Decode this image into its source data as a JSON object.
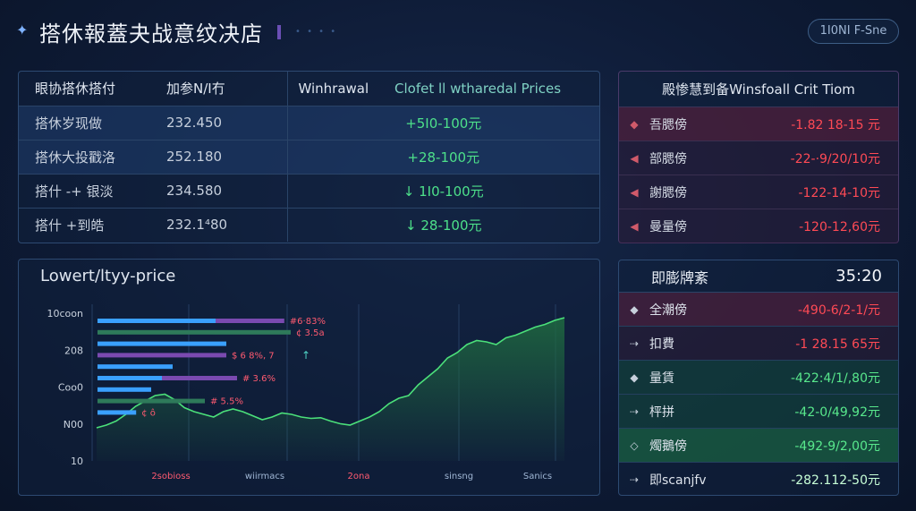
{
  "header": {
    "title": "搭休報蓋夬战意纹决店",
    "mode_label": "1I0NI F-Sne"
  },
  "prices_table": {
    "headers": [
      "眼协搭休搭付",
      "加参N/I冇",
      "Winhrawal",
      "Clofet ll wtharedal Prices"
    ],
    "rows": [
      {
        "name": "搭休岁现做",
        "value": "232.450",
        "price": "+5I0-100元"
      },
      {
        "name": "搭休大投戳洛",
        "value": "252.180",
        "price": "+28-100元"
      },
      {
        "name": "搭什 -+ 银淡",
        "value": "234.580",
        "price": "↓ 1I0-100元"
      },
      {
        "name": "搭什 +到皓",
        "value": "232.1⁴80",
        "price": "↓ 28-100元"
      }
    ]
  },
  "withdrawal_panel": {
    "title": "殿惨慧到备Winsfoall Crit Tiom",
    "rows": [
      {
        "icon": "◆",
        "label": "吾腮傍",
        "value": "-1.82 18-15 元"
      },
      {
        "icon": "◀",
        "label": "部腮傍",
        "value": "-22-·9/20/10元"
      },
      {
        "icon": "◀",
        "label": "謝腮傍",
        "value": "-122-14-10元"
      },
      {
        "icon": "◀",
        "label": "曼量傍",
        "value": "-120-12,60元"
      }
    ]
  },
  "live_panel": {
    "title": "即膨牌紊",
    "time": "35:20",
    "rows": [
      {
        "icon": "◆",
        "label": "全潮傍",
        "value": "-490-6/2-1/元",
        "kind": "neg"
      },
      {
        "icon": "⇢",
        "label": "扣費",
        "value": "-1 28.15 65元",
        "kind": "neg2"
      },
      {
        "icon": "◆",
        "label": "量賃",
        "value": "-422:4/1/,80元",
        "kind": "pos"
      },
      {
        "icon": "⇢",
        "label": "枰拼",
        "value": "-42-0/49,92元",
        "kind": "pos"
      },
      {
        "icon": "◇",
        "label": "燭鵝傍",
        "value": "-492-9/2,00元",
        "kind": "pos2"
      },
      {
        "icon": "⇢",
        "label": "即scanjfv",
        "value": "-282.112-50元",
        "kind": "plain"
      }
    ]
  },
  "chart_panel": {
    "title": "Lowert/ltyy-price"
  },
  "chart_data": {
    "type": "area",
    "title": "Lowert/ltyy-price",
    "y_tick_labels": [
      "10coon",
      "208",
      "Coo0",
      "N00",
      "10"
    ],
    "x_tick_labels": [
      "2sobioss",
      "wiirmacs",
      "2ona",
      "sinsng",
      "Sanics"
    ],
    "x": [
      0,
      0.25,
      0.5,
      0.75,
      1,
      1.25,
      1.5,
      1.75,
      2,
      2.25,
      2.5,
      2.75,
      3,
      3.25,
      3.5,
      3.75,
      4,
      4.25,
      4.5,
      4.75,
      5,
      5.25,
      5.5,
      5.75,
      6,
      6.25,
      6.5,
      6.75,
      7,
      7.25,
      7.5,
      7.75,
      8,
      8.25,
      8.5,
      8.75,
      9,
      9.25,
      9.5,
      9.75,
      10,
      10.25,
      10.5,
      10.75,
      11,
      11.25,
      11.5,
      11.75,
      12
    ],
    "y": [
      180,
      200,
      230,
      280,
      340,
      380,
      420,
      430,
      390,
      330,
      300,
      280,
      260,
      300,
      320,
      300,
      270,
      240,
      260,
      290,
      280,
      260,
      250,
      255,
      230,
      210,
      200,
      230,
      260,
      300,
      360,
      400,
      420,
      500,
      560,
      620,
      700,
      740,
      800,
      830,
      820,
      800,
      850,
      870,
      900,
      930,
      950,
      980,
      1000
    ],
    "ylim": [
      0,
      1100
    ],
    "bars": [
      {
        "label": "#6·83%",
        "values": [
          0.55,
          0.32
        ],
        "colors": [
          "#3aa0ff",
          "#7a4ab0"
        ]
      },
      {
        "label": "¢ 3.5a",
        "values": [
          0.9
        ],
        "colors": [
          "#2e7a5a"
        ]
      },
      {
        "label": "",
        "values": [
          0.6
        ],
        "colors": [
          "#3aa0ff"
        ]
      },
      {
        "label": "$ 6 8%, 7",
        "values": [
          0.6
        ],
        "colors": [
          "#7a4ab0"
        ]
      },
      {
        "label": "",
        "values": [
          0.35
        ],
        "colors": [
          "#3aa0ff"
        ]
      },
      {
        "label": "# 3.6%",
        "values": [
          0.3,
          0.35
        ],
        "colors": [
          "#3aa0ff",
          "#7a4ab0"
        ]
      },
      {
        "label": "",
        "values": [
          0.25
        ],
        "colors": [
          "#3aa0ff"
        ]
      },
      {
        "label": "# 5.5%",
        "values": [
          0.5
        ],
        "colors": [
          "#2e7a5a"
        ]
      },
      {
        "label": "¢ ô",
        "values": [
          0.18
        ],
        "colors": [
          "#3aa0ff"
        ]
      }
    ],
    "colors": {
      "line": "#4be07a",
      "fill": "#1f6a40",
      "bar_blue": "#3aa0ff",
      "bar_purple": "#7a4ab0",
      "bar_green": "#2e7a5a",
      "label_red": "#ff5a70"
    }
  }
}
